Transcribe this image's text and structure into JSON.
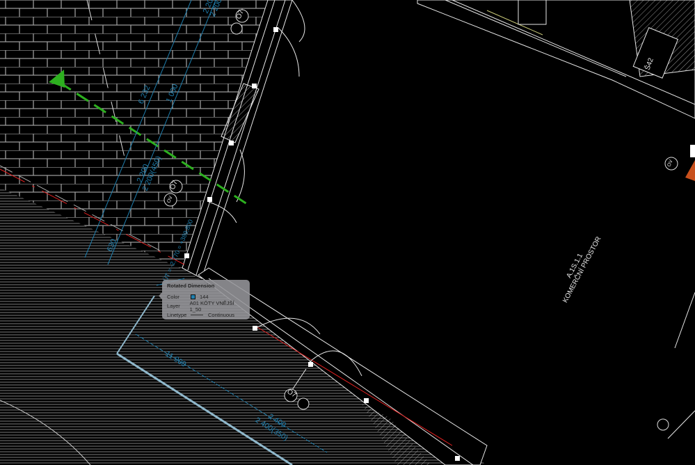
{
  "drawing": {
    "room_number": "A.1S.1.1",
    "room_name": "KOMERČNÍ PROSTOR",
    "dimensions": [
      "6 232",
      "1 000",
      "2 200",
      "2 200(450)",
      "2 200",
      "2 200(450)",
      "630",
      "11 900",
      "2 400",
      "2 400(350)",
      "ÚT = -2,770 = +389,800"
    ],
    "tags": [
      "O7",
      "O7",
      "O7",
      "OV",
      "OV",
      "Š42"
    ],
    "colors": {
      "background": "#000000",
      "dimension": "#1f7fae",
      "section_line": "#2db01f",
      "lines": "#e8e8e8",
      "red_line": "#e02020"
    }
  },
  "tooltip": {
    "title": "Rotated Dimension",
    "color_label": "Color",
    "color_value": "144",
    "layer_label": "Layer",
    "layer_value": "A01 KÓTY VNĚJŠÍ 1_50",
    "linetype_label": "Linetype",
    "linetype_value": "Continuous"
  }
}
